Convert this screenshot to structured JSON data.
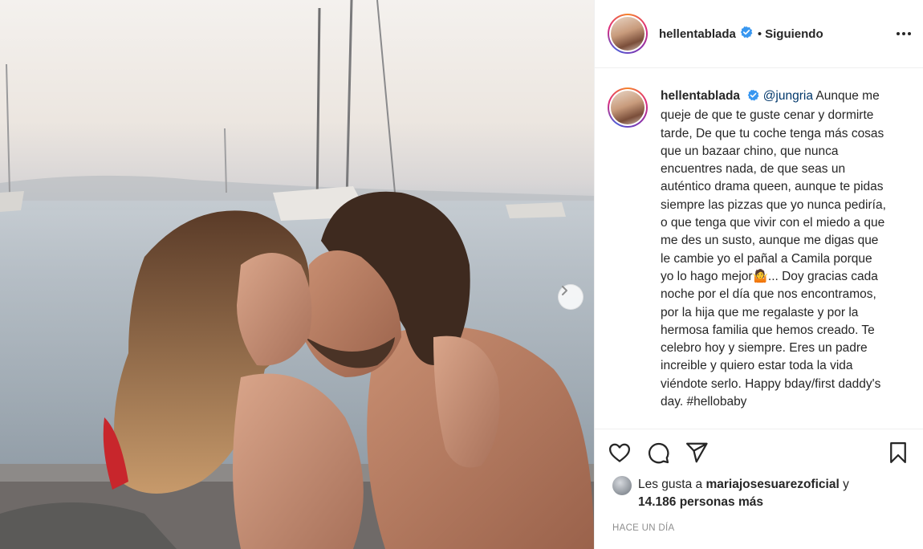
{
  "post": {
    "username": "hellentablada",
    "follow_separator": "•",
    "follow_status": "Siguiendo",
    "caption": {
      "username": "hellentablada",
      "mention": "@jungria",
      "text": "Aunque me queje de que te guste cenar y dormirte tarde, De que tu coche tenga más cosas que un bazaar chino, que nunca encuentres nada, de que seas un auténtico drama queen, aunque te pidas siempre las pizzas que yo nunca pediría, o que tenga que vivir con el miedo a que me des un susto, aunque me digas que le cambie yo el pañal a Camila porque yo lo hago mejor🤷... Doy gracias cada noche por el día que nos encontramos, por la hija que me regalaste y por la hermosa familia que hemos creado. Te celebro hoy y siempre. Eres un padre increible y quiero estar toda la vida viéndote serlo. Happy bday/first daddy's day. #hellobaby"
    },
    "likes": {
      "prefix": "Les gusta a",
      "liker": "mariajosesuarezoficial",
      "connector": "y",
      "count": "14.186 personas más"
    },
    "timestamp": "HACE UN DÍA"
  },
  "icons": {
    "verified": "verified-badge-icon",
    "more": "more-options-icon",
    "like": "heart-icon",
    "comment": "comment-icon",
    "share": "paper-plane-icon",
    "save": "bookmark-icon",
    "next": "chevron-right-icon"
  },
  "colors": {
    "verified": "#3897f0",
    "mention": "#00376b",
    "muted": "#8e8e8e",
    "text": "#262626"
  }
}
